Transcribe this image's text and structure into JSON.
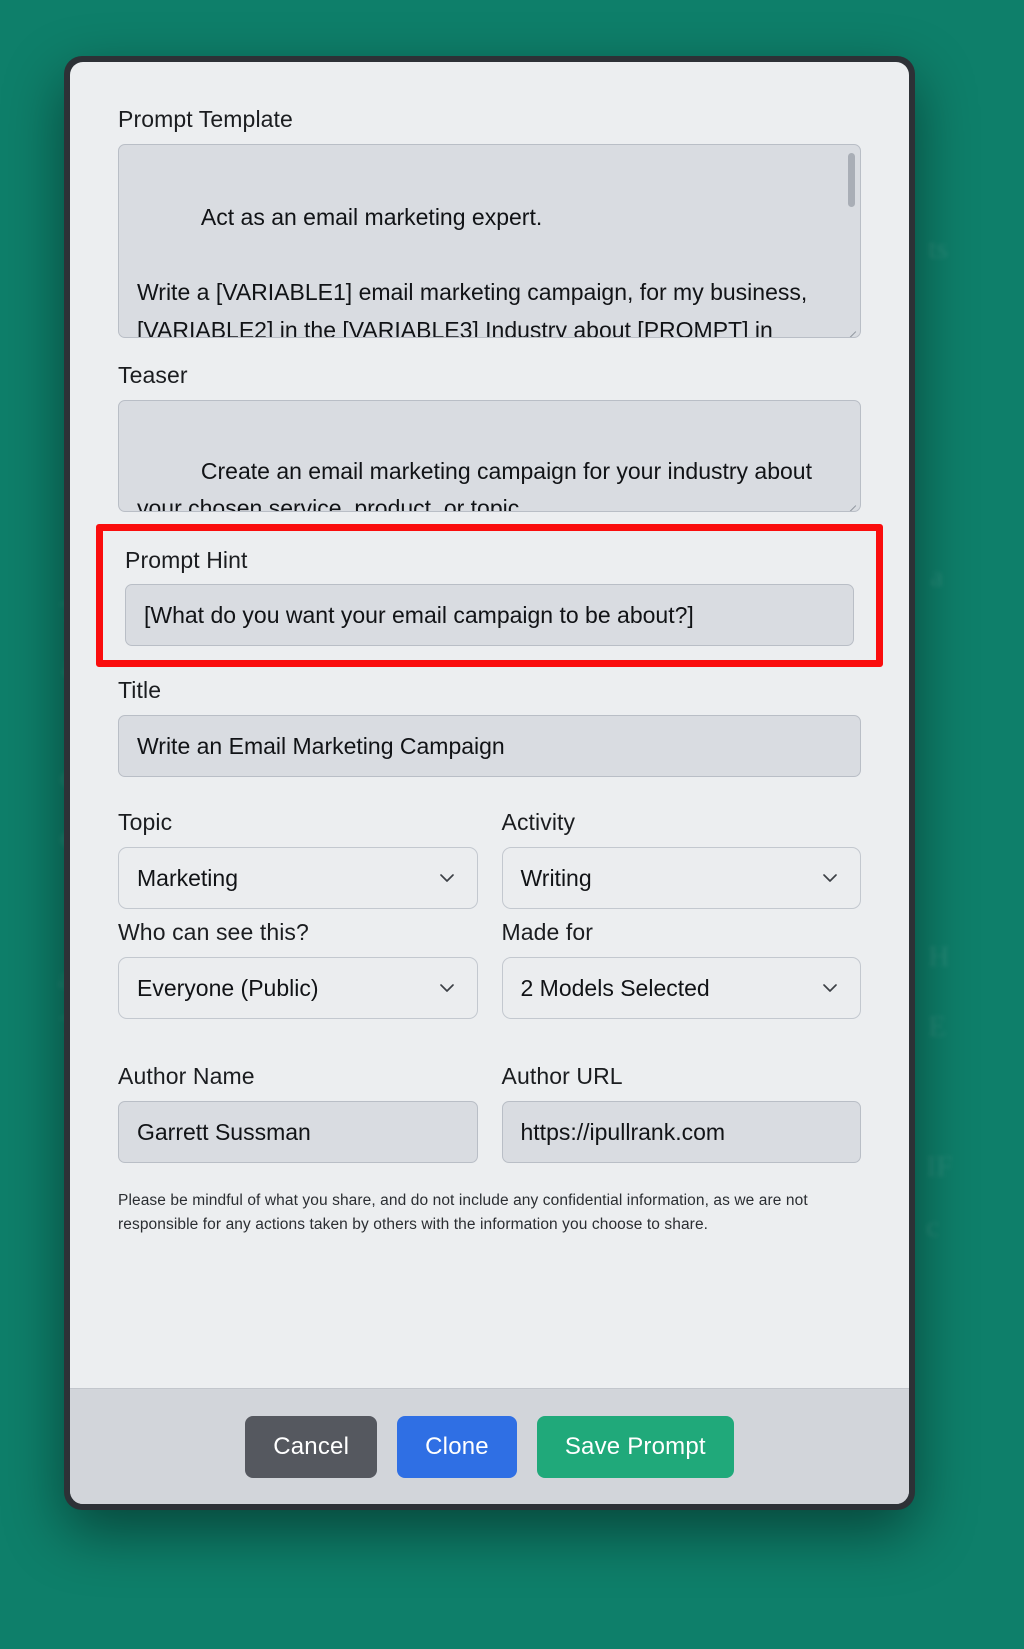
{
  "dialog": {
    "prompt_template": {
      "label": "Prompt Template",
      "value": "Act as an email marketing expert.\n\nWrite a [VARIABLE1] email marketing campaign, for my business, [VARIABLE2] in the [VARIABLE3] Industry about [PROMPT] in [TARGETLANGUAGE]. Make sure that the"
    },
    "teaser": {
      "label": "Teaser",
      "value": "Create an email marketing campaign for your industry about your chosen service, product, or topic."
    },
    "prompt_hint": {
      "label": "Prompt Hint",
      "value": "[What do you want your email campaign to be about?]"
    },
    "title": {
      "label": "Title",
      "value": "Write an Email Marketing Campaign"
    },
    "topic": {
      "label": "Topic",
      "value": "Marketing"
    },
    "activity": {
      "label": "Activity",
      "value": "Writing"
    },
    "visibility": {
      "label": "Who can see this?",
      "value": "Everyone (Public)"
    },
    "made_for": {
      "label": "Made for",
      "value": "2 Models Selected"
    },
    "author_name": {
      "label": "Author Name",
      "value": "Garrett Sussman"
    },
    "author_url": {
      "label": "Author URL",
      "value": "https://ipullrank.com"
    },
    "disclaimer": "Please be mindful of what you share, and do not include any confidential information, as we are not responsible for any actions taken by others with the information you choose to share.",
    "buttons": {
      "cancel": "Cancel",
      "clone": "Clone",
      "save": "Save Prompt"
    },
    "icons": {
      "chevron_down": "chevron-down-icon"
    },
    "colors": {
      "highlight": "#fa0d0d",
      "cancel": "#55585f",
      "clone": "#2f6fe4",
      "save": "#20a97a",
      "backdrop": "#0d7d6a"
    }
  }
}
